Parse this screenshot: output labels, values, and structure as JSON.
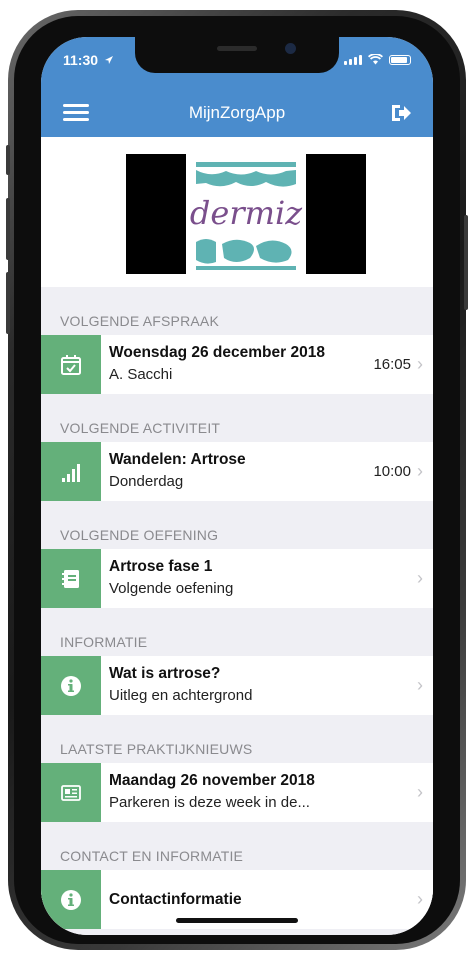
{
  "status": {
    "time": "11:30"
  },
  "header": {
    "title": "MijnZorgApp"
  },
  "logo": {
    "text": "dermiz"
  },
  "sections": [
    {
      "heading": "VOLGENDE AFSPRAAK",
      "title": "Woensdag 26 december 2018",
      "subtitle": "A. Sacchi",
      "time": "16:05",
      "icon": "calendar-check-icon"
    },
    {
      "heading": "VOLGENDE ACTIVITEIT",
      "title": "Wandelen: Artrose",
      "subtitle": "Donderdag",
      "time": "10:00",
      "icon": "signal-bars-icon"
    },
    {
      "heading": "VOLGENDE OEFENING",
      "title": "Artrose fase 1",
      "subtitle": "Volgende oefening",
      "time": "",
      "icon": "notebook-icon"
    },
    {
      "heading": "INFORMATIE",
      "title": "Wat is artrose?",
      "subtitle": "Uitleg en achtergrond",
      "time": "",
      "icon": "info-icon"
    },
    {
      "heading": "LAATSTE PRAKTIJKNIEUWS",
      "title": "Maandag 26 november 2018",
      "subtitle": "Parkeren is deze week in de...",
      "time": "",
      "icon": "newspaper-icon"
    },
    {
      "heading": "CONTACT EN INFORMATIE",
      "title": "Contactinformatie",
      "subtitle": "",
      "time": "",
      "icon": "info-icon"
    }
  ],
  "colors": {
    "header_blue": "#4a8ccd",
    "icon_green": "#64b07a",
    "section_bg": "#efeff4",
    "logo_teal": "#5fb3b3",
    "logo_purple": "#7a4f8c"
  }
}
